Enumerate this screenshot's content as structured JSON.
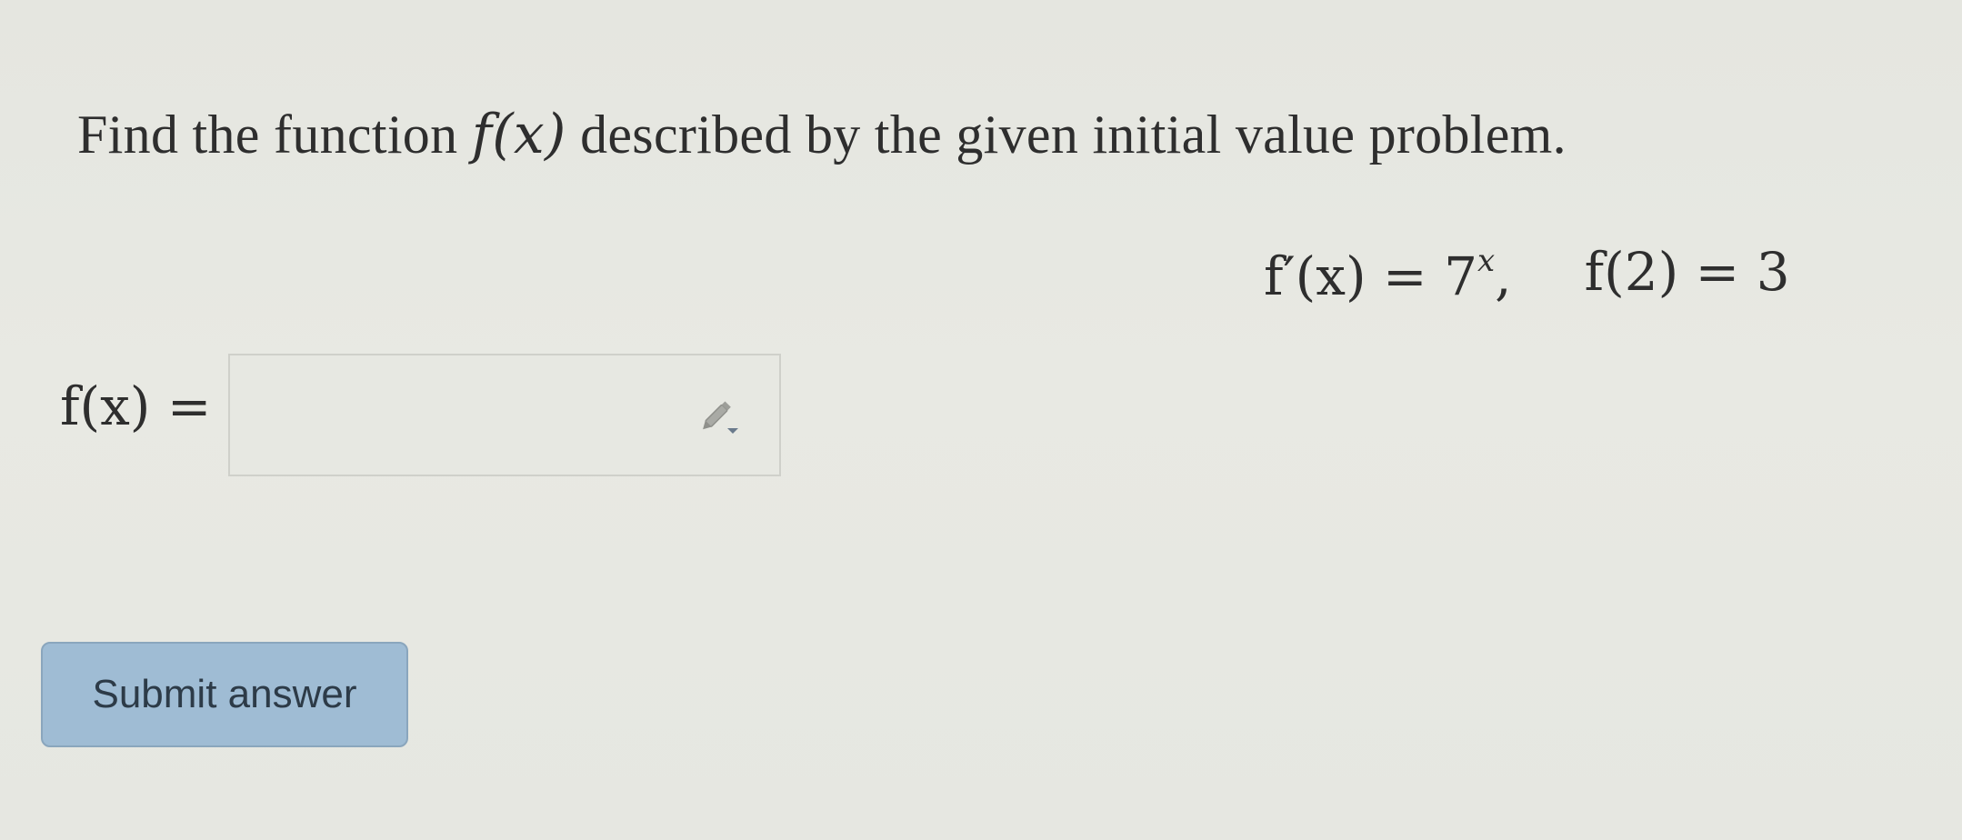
{
  "question": {
    "prompt_before": "Find the function ",
    "prompt_math": "f(x)",
    "prompt_after": " described by the given initial value problem."
  },
  "equation": {
    "derivative_lhs": "f′(x) = 7",
    "derivative_exponent": "x",
    "derivative_sep": ",",
    "initial_condition": "f(2) = 3"
  },
  "answer": {
    "label": "f(x) =",
    "value": "",
    "placeholder": ""
  },
  "icons": {
    "input_tool": "pencil-dropdown-icon"
  },
  "buttons": {
    "submit_label": "Submit answer"
  },
  "colors": {
    "button_bg": "#9fbcd4",
    "page_bg": "#e7e8e2"
  }
}
